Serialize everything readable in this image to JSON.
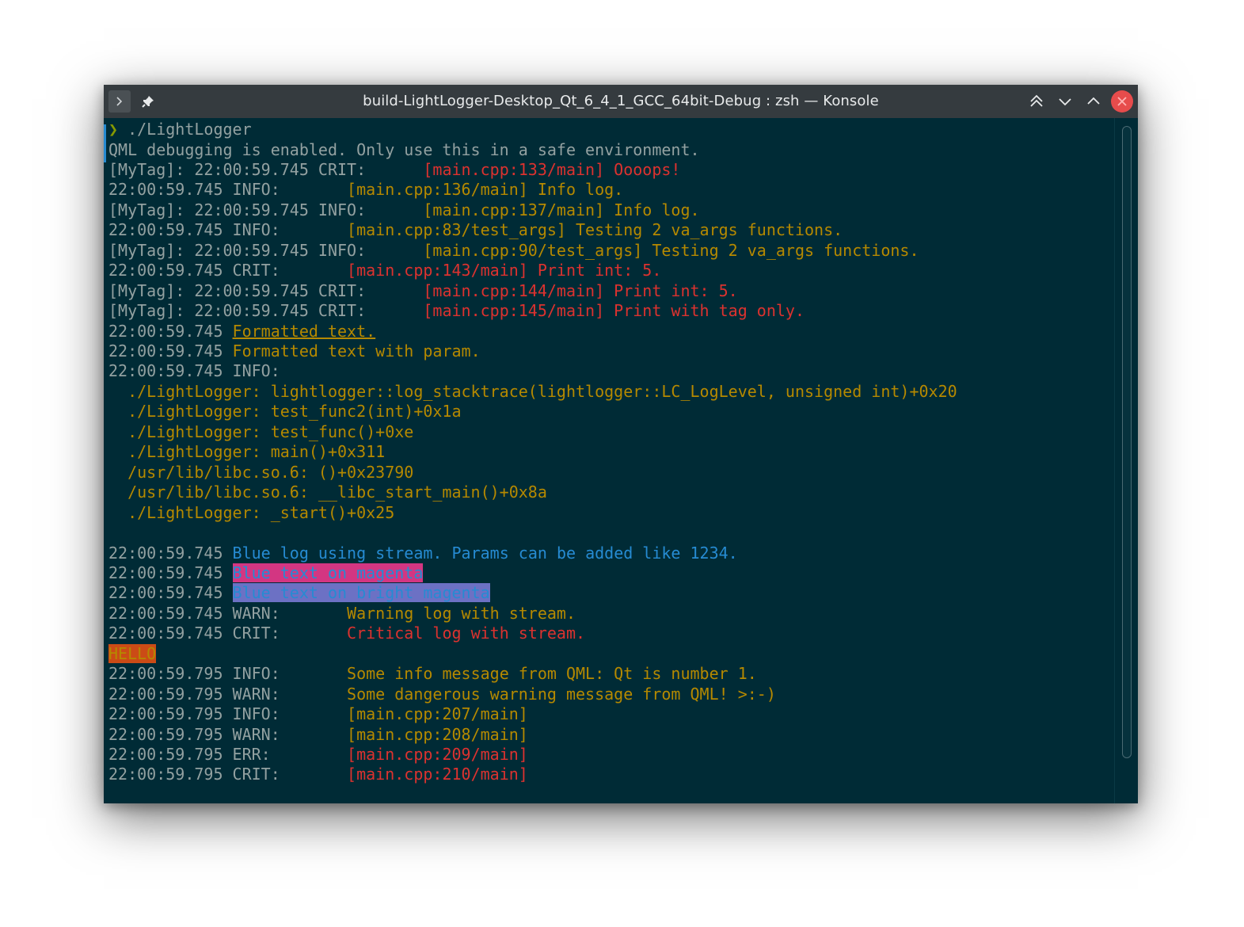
{
  "window": {
    "title": "build-LightLogger-Desktop_Qt_6_4_1_GCC_64bit-Debug : zsh — Konsole",
    "buttons": {
      "menu_icon": "terminal-prompt-icon",
      "pin_icon": "pin-icon",
      "keep_above_icon": "double-chevron-up-icon",
      "keep_below_icon": "chevron-down-icon",
      "maximize_icon": "chevron-up-icon",
      "close_icon": "close-icon"
    }
  },
  "colors": {
    "terminal_background": "#002b36",
    "titlebar": "#353b3f",
    "red": "#dc322f",
    "yellow": "#b58900",
    "green": "#859900",
    "blue": "#268bd2",
    "magenta": "#d33682",
    "bright_magenta": "#6c71c4",
    "orange": "#cb4b16",
    "close_button": "#e74c4c"
  },
  "terminal": {
    "prompt_symbol": "❯",
    "command": "./LightLogger",
    "lines": [
      {
        "segments": [
          {
            "text": "QML debugging is enabled. Only use this in a safe environment.",
            "style": "base"
          }
        ]
      },
      {
        "segments": [
          {
            "text": "[MyTag]: 22:00:59.745 CRIT:      ",
            "style": "base"
          },
          {
            "text": "[main.cpp:133/main] Oooops!",
            "style": "red"
          }
        ]
      },
      {
        "segments": [
          {
            "text": "22:00:59.745 INFO:       ",
            "style": "base"
          },
          {
            "text": "[main.cpp:136/main] Info log.",
            "style": "yellow"
          }
        ]
      },
      {
        "segments": [
          {
            "text": "[MyTag]: 22:00:59.745 INFO:      ",
            "style": "base"
          },
          {
            "text": "[main.cpp:137/main] Info log.",
            "style": "yellow"
          }
        ]
      },
      {
        "segments": [
          {
            "text": "22:00:59.745 INFO:       ",
            "style": "base"
          },
          {
            "text": "[main.cpp:83/test_args] Testing 2 va_args functions.",
            "style": "yellow"
          }
        ]
      },
      {
        "segments": [
          {
            "text": "[MyTag]: 22:00:59.745 INFO:      ",
            "style": "base"
          },
          {
            "text": "[main.cpp:90/test_args] Testing 2 va_args functions.",
            "style": "yellow"
          }
        ]
      },
      {
        "segments": [
          {
            "text": "22:00:59.745 CRIT:       ",
            "style": "base"
          },
          {
            "text": "[main.cpp:143/main] Print int: 5.",
            "style": "red"
          }
        ]
      },
      {
        "segments": [
          {
            "text": "[MyTag]: 22:00:59.745 CRIT:      ",
            "style": "base"
          },
          {
            "text": "[main.cpp:144/main] Print int: 5.",
            "style": "red"
          }
        ]
      },
      {
        "segments": [
          {
            "text": "[MyTag]: 22:00:59.745 CRIT:      ",
            "style": "base"
          },
          {
            "text": "[main.cpp:145/main] Print with tag only.",
            "style": "red"
          }
        ]
      },
      {
        "segments": [
          {
            "text": "22:00:59.745 ",
            "style": "base"
          },
          {
            "text": "Formatted text.",
            "style": "yellow-underline"
          }
        ]
      },
      {
        "segments": [
          {
            "text": "22:00:59.745 ",
            "style": "base"
          },
          {
            "text": "Formatted text with param.",
            "style": "yellow"
          }
        ]
      },
      {
        "segments": [
          {
            "text": "22:00:59.745 INFO:",
            "style": "base"
          }
        ]
      },
      {
        "segments": [
          {
            "text": "  ./LightLogger: lightlogger::log_stacktrace(lightlogger::LC_LogLevel, unsigned int)+0x20",
            "style": "yellow"
          }
        ]
      },
      {
        "segments": [
          {
            "text": "  ./LightLogger: test_func2(int)+0x1a",
            "style": "yellow"
          }
        ]
      },
      {
        "segments": [
          {
            "text": "  ./LightLogger: test_func()+0xe",
            "style": "yellow"
          }
        ]
      },
      {
        "segments": [
          {
            "text": "  ./LightLogger: main()+0x311",
            "style": "yellow"
          }
        ]
      },
      {
        "segments": [
          {
            "text": "  /usr/lib/libc.so.6: ()+0x23790",
            "style": "yellow"
          }
        ]
      },
      {
        "segments": [
          {
            "text": "  /usr/lib/libc.so.6: __libc_start_main()+0x8a",
            "style": "yellow"
          }
        ]
      },
      {
        "segments": [
          {
            "text": "  ./LightLogger: _start()+0x25",
            "style": "yellow"
          }
        ]
      },
      {
        "segments": []
      },
      {
        "segments": [
          {
            "text": "22:00:59.745 ",
            "style": "base"
          },
          {
            "text": "Blue log using stream. Params can be added like 1234.",
            "style": "blue"
          }
        ]
      },
      {
        "segments": [
          {
            "text": "22:00:59.745 ",
            "style": "base"
          },
          {
            "text": "Blue text on magenta",
            "style": "blue-on-magenta"
          }
        ]
      },
      {
        "segments": [
          {
            "text": "22:00:59.745 ",
            "style": "base"
          },
          {
            "text": "Blue text on bright magenta",
            "style": "blue-on-bright-magenta"
          }
        ]
      },
      {
        "segments": [
          {
            "text": "22:00:59.745 WARN:       ",
            "style": "base"
          },
          {
            "text": "Warning log with stream.",
            "style": "yellow"
          }
        ]
      },
      {
        "segments": [
          {
            "text": "22:00:59.745 CRIT:       ",
            "style": "base"
          },
          {
            "text": "Critical log with stream.",
            "style": "red"
          }
        ]
      },
      {
        "segments": [
          {
            "text": "HELLO",
            "style": "yellow-on-orange"
          }
        ]
      },
      {
        "segments": [
          {
            "text": "22:00:59.795 INFO:       ",
            "style": "base"
          },
          {
            "text": "Some info message from QML: Qt is number 1.",
            "style": "yellow"
          }
        ]
      },
      {
        "segments": [
          {
            "text": "22:00:59.795 WARN:       ",
            "style": "base"
          },
          {
            "text": "Some dangerous warning message from QML! >:-)",
            "style": "yellow"
          }
        ]
      },
      {
        "segments": [
          {
            "text": "22:00:59.795 INFO:       ",
            "style": "base"
          },
          {
            "text": "[main.cpp:207/main]",
            "style": "yellow"
          }
        ]
      },
      {
        "segments": [
          {
            "text": "22:00:59.795 WARN:       ",
            "style": "base"
          },
          {
            "text": "[main.cpp:208/main]",
            "style": "yellow"
          }
        ]
      },
      {
        "segments": [
          {
            "text": "22:00:59.795 ERR:        ",
            "style": "base"
          },
          {
            "text": "[main.cpp:209/main]",
            "style": "red"
          }
        ]
      },
      {
        "segments": [
          {
            "text": "22:00:59.795 CRIT:       ",
            "style": "base"
          },
          {
            "text": "[main.cpp:210/main]",
            "style": "red"
          }
        ]
      }
    ]
  }
}
